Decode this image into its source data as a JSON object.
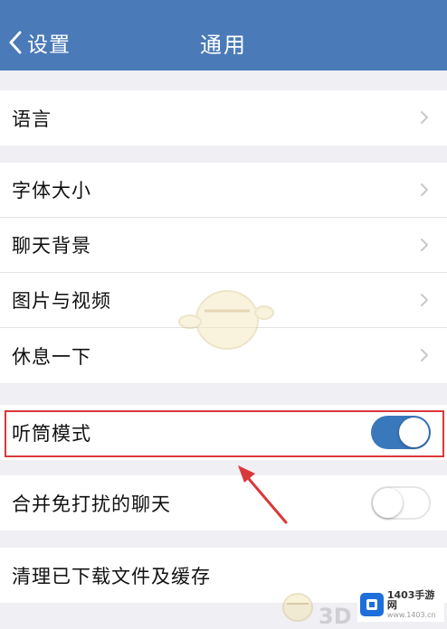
{
  "navbar": {
    "back_label": "设置",
    "title": "通用"
  },
  "groups": {
    "language": {
      "label": "语言"
    },
    "font_size": {
      "label": "字体大小"
    },
    "chat_background": {
      "label": "聊天背景"
    },
    "photos_videos": {
      "label": "图片与视频"
    },
    "rest": {
      "label": "休息一下"
    },
    "earpiece_mode": {
      "label": "听筒模式",
      "enabled": true
    },
    "merge_dnd_chats": {
      "label": "合并免打扰的聊天",
      "enabled": false
    },
    "clear_cache": {
      "label": "清理已下载文件及缓存"
    }
  },
  "watermark": {
    "text_3d": "3D",
    "site_name": "1403手游网",
    "site_url": "www.1403.cn"
  },
  "colors": {
    "nav_bg": "#4a7ab8",
    "toggle_on": "#3a78bc",
    "highlight": "#d9383a",
    "page_bg": "#efeff4"
  },
  "icons": {
    "back": "chevron-left-icon",
    "disclosure": "chevron-right-icon"
  }
}
